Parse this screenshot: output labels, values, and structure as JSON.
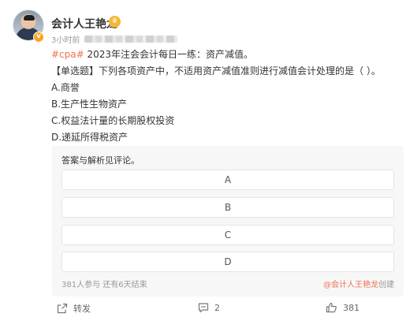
{
  "post": {
    "author": "会计人王艳龙",
    "time_label": "3小时前",
    "hashtag": "#cpa#",
    "headline": " 2023年注会会计每日一练：资产减值。",
    "question": "【单选题】下列各项资产中，不适用资产减值准则进行减值会计处理的是（   ）。",
    "choices": [
      "A.商誉",
      "B.生产性生物资产",
      "C.权益法计量的长期股权投资",
      "D.递延所得税资产"
    ]
  },
  "poll": {
    "title": "答案与解析见评论。",
    "options": [
      "A",
      "B",
      "C",
      "D"
    ],
    "stats": "381人参与  还有6天结束",
    "creator_name": "@会计人王艳龙",
    "creator_suffix": "创建"
  },
  "actions": {
    "repost_label": "转发",
    "comment_count": "2",
    "like_count": "381"
  },
  "icons": {
    "verified": "verified-badge-icon",
    "crown": "crown-badge-icon",
    "repost": "repost-icon",
    "comment": "comment-icon",
    "like": "thumbs-up-icon"
  },
  "colors": {
    "hashtag": "#eb7350",
    "verified": "#f6a623",
    "poll_background": "#f7f7f7"
  }
}
